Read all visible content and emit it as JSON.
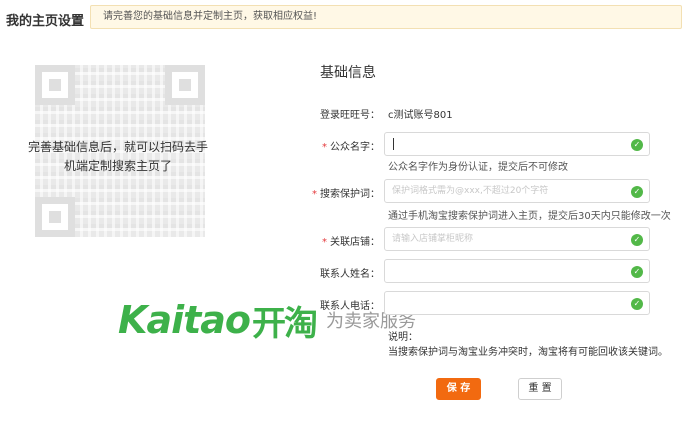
{
  "header": {
    "title": "我的主页设置",
    "notice": "请完善您的基础信息并定制主页，获取相应权益!"
  },
  "left": {
    "qr_caption_line1": "完善基础信息后，就可以扫码去手",
    "qr_caption_line2": "机端定制搜索主页了"
  },
  "watermark": {
    "brand": "Kaitao",
    "brand_cn": "开淘",
    "slogan": "为卖家服务"
  },
  "form": {
    "section_title": "基础信息",
    "account_label": "登录旺旺号：",
    "account_value": "c测试账号801",
    "fields": [
      {
        "label": "公众名字：",
        "required": true,
        "value": "",
        "placeholder": "",
        "hint": "公众名字作为身份认证，提交后不可修改"
      },
      {
        "label": "搜索保护词：",
        "required": true,
        "value": "",
        "placeholder": "保护词格式需为@xxx,不超过20个字符",
        "hint": "通过手机淘宝搜索保护词进入主页，提交后30天内只能修改一次"
      },
      {
        "label": "关联店铺：",
        "required": true,
        "value": "",
        "placeholder": "请输入店铺掌柜昵称",
        "hint": ""
      },
      {
        "label": "联系人姓名：",
        "required": false,
        "value": "",
        "placeholder": "",
        "hint": ""
      },
      {
        "label": "联系人电话：",
        "required": false,
        "value": "",
        "placeholder": "",
        "hint": ""
      }
    ],
    "required_mark": "*",
    "note_title": "说明：",
    "note_text": "当搜索保护词与淘宝业务冲突时，淘宝将有可能回收该关键词。",
    "save_label": "保 存",
    "reset_label": "重 置"
  },
  "colors": {
    "accent": "#f26a10",
    "notice_bg": "#fff8e6",
    "valid": "#52b848",
    "brand_green": "#3db14a"
  }
}
